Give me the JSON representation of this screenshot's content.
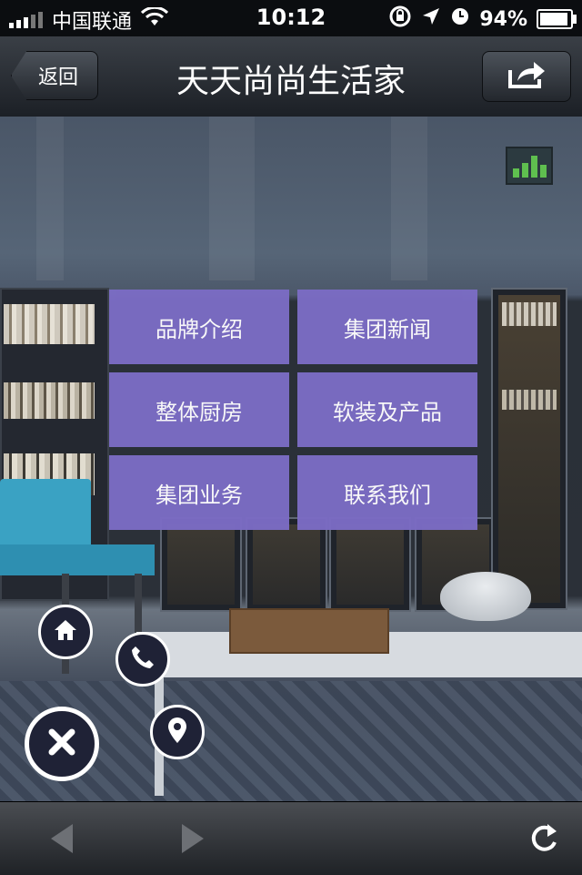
{
  "status_bar": {
    "carrier": "中国联通",
    "time": "10:12",
    "battery": "94%",
    "battery_level": 0.94,
    "icons": [
      "signal-icon",
      "wifi-icon",
      "rotation-lock-icon",
      "location-arrow-icon",
      "alarm-icon",
      "battery-icon"
    ]
  },
  "navbar": {
    "back_label": "返回",
    "title": "天天尚尚生活家",
    "share_icon": "share-icon"
  },
  "menu": {
    "items": [
      {
        "label": "品牌介绍"
      },
      {
        "label": "集团新闻"
      },
      {
        "label": "整体厨房"
      },
      {
        "label": "软装及产品"
      },
      {
        "label": "集团业务"
      },
      {
        "label": "联系我们"
      }
    ],
    "tile_color": "#7b6cc4"
  },
  "floating_buttons": [
    "home-icon",
    "phone-icon",
    "map-pin-icon",
    "close-icon"
  ],
  "toolbar": {
    "icons": [
      "back-arrow-icon",
      "forward-arrow-icon",
      "reload-icon"
    ]
  },
  "colors": {
    "stat_green": "#5fbf4f",
    "circle_bg": "#1f2236"
  }
}
